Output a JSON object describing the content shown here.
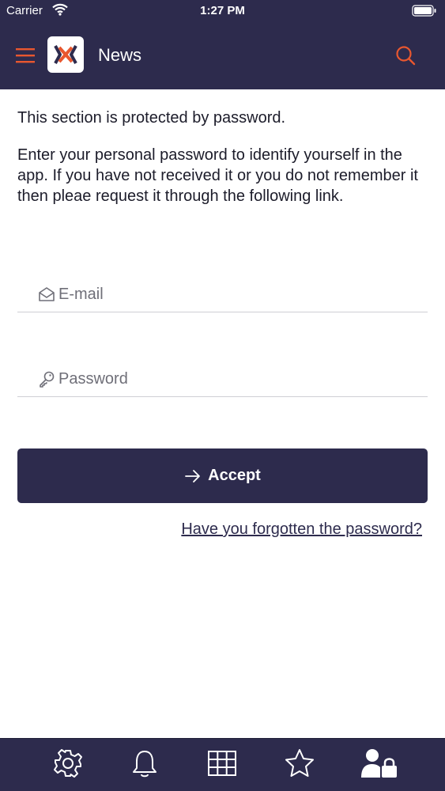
{
  "status_bar": {
    "carrier": "Carrier",
    "time": "1:27 PM"
  },
  "header": {
    "title": "News",
    "icons": [
      "hamburger-menu-icon",
      "app-logo",
      "search-icon"
    ]
  },
  "content": {
    "intro_line1": "This section is protected by password.",
    "intro_line2": "Enter your personal password to identify yourself in the app. If you have not received it or you do not remember it then pleae request it through the following link."
  },
  "form": {
    "email": {
      "placeholder": "E-mail",
      "value": ""
    },
    "password": {
      "placeholder": "Password",
      "value": ""
    },
    "accept_label": "Accept",
    "forgot_label": "Have you forgotten the password?"
  },
  "tabbar": {
    "items": [
      "settings-icon",
      "notifications-bell-icon",
      "grid-icon",
      "favorites-star-icon",
      "user-lock-icon"
    ]
  },
  "colors": {
    "primary": "#2d2b4d",
    "accent": "#e8572f",
    "white": "#ffffff"
  }
}
